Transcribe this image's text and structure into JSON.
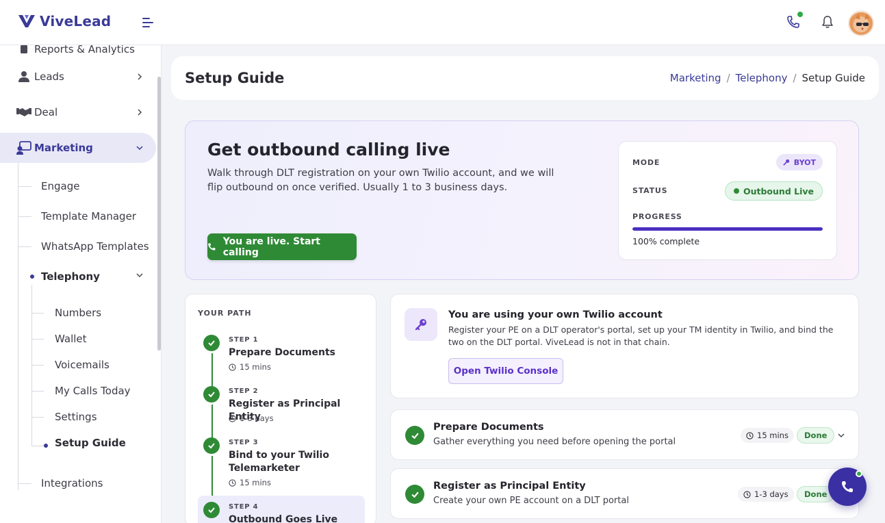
{
  "app": {
    "brand": "ViveLead"
  },
  "sidebar": {
    "cutoff_item": "Reports & Analytics",
    "items": [
      {
        "label": "Leads",
        "icon": "user-icon"
      },
      {
        "label": "Deal",
        "icon": "handshake-icon"
      },
      {
        "label": "Marketing",
        "icon": "marketing-icon"
      }
    ],
    "marketing_children": [
      "Engage",
      "Template Manager",
      "WhatsApp Templates",
      "Telephony"
    ],
    "telephony_children": [
      "Numbers",
      "Wallet",
      "Voicemails",
      "My Calls Today",
      "Settings",
      "Setup Guide"
    ],
    "after": "Integrations"
  },
  "header": {
    "title": "Setup Guide",
    "breadcrumb": [
      "Marketing",
      "Telephony",
      "Setup Guide"
    ],
    "sep": "/"
  },
  "hero": {
    "title": "Get outbound calling live",
    "description": "Walk through DLT registration on your own Twilio account, and we will flip outbound on once verified. Usually 1 to 3 business days.",
    "cta": "You are live. Start calling",
    "mode_label": "MODE",
    "mode_value": "BYOT",
    "status_label": "STATUS",
    "status_value": "Outbound Live",
    "progress_label": "PROGRESS",
    "progress_value": 1.0,
    "progress_text": "100% complete"
  },
  "path": {
    "heading": "YOUR PATH",
    "steps": [
      {
        "num": "STEP 1",
        "title": "Prepare Documents",
        "time": "15 mins"
      },
      {
        "num": "STEP 2",
        "title": "Register as Principal Entity",
        "time": "1-3 days"
      },
      {
        "num": "STEP 3",
        "title": "Bind to your Twilio Telemarketer",
        "time": "15 mins"
      },
      {
        "num": "STEP 4",
        "title": "Outbound Goes Live",
        "time": ""
      }
    ]
  },
  "info": {
    "title": "You are using your own Twilio account",
    "description": "Register your PE on a DLT operator's portal, set up your TM identity in Twilio, and bind the two on the DLT portal. ViveLead is not in that chain.",
    "button": "Open Twilio Console"
  },
  "accordions": [
    {
      "title": "Prepare Documents",
      "subtitle": "Gather everything you need before opening the portal",
      "time": "15 mins",
      "status": "Done"
    },
    {
      "title": "Register as Principal Entity",
      "subtitle": "Create your own PE account on a DLT portal",
      "time": "1-3 days",
      "status": "Done"
    }
  ],
  "colors": {
    "brand": "#3a3a99",
    "success": "#2f8a36",
    "accent": "#5b30c8"
  }
}
